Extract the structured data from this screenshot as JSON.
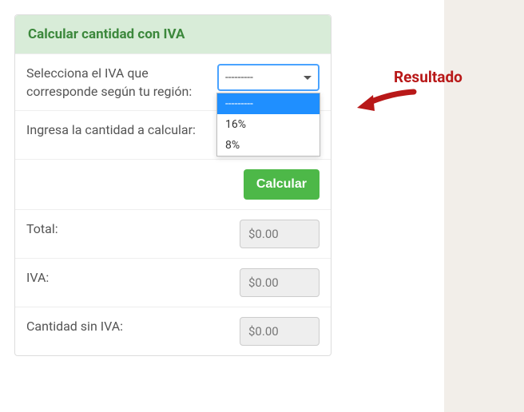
{
  "card": {
    "title": "Calcular cantidad con IVA",
    "rows": {
      "iva_select": {
        "label": "Selecciona el IVA que corresponde según tu región:",
        "value": "---------"
      },
      "amount": {
        "label": "Ingresa la cantidad a calcular:"
      },
      "total": {
        "label": "Total:",
        "value": "$0.00"
      },
      "iva": {
        "label": "IVA:",
        "value": "$0.00"
      },
      "sin_iva": {
        "label": "Cantidad sin IVA:",
        "value": "$0.00"
      }
    },
    "button": "Calcular"
  },
  "dropdown": {
    "selected": "---------",
    "options": [
      "16%",
      "8%"
    ]
  },
  "callout": "Resultado"
}
